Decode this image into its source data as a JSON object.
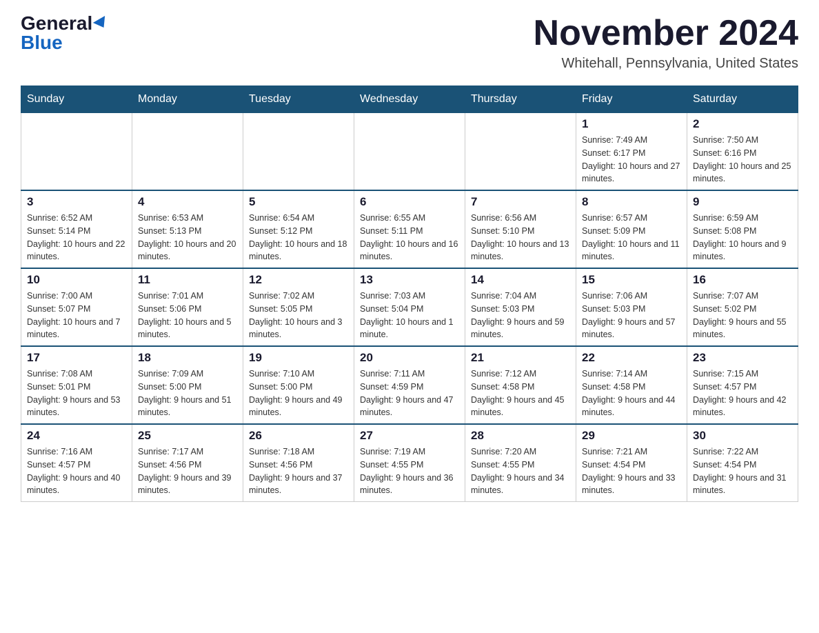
{
  "header": {
    "logo_general": "General",
    "logo_blue": "Blue",
    "month_title": "November 2024",
    "location": "Whitehall, Pennsylvania, United States"
  },
  "calendar": {
    "days_of_week": [
      "Sunday",
      "Monday",
      "Tuesday",
      "Wednesday",
      "Thursday",
      "Friday",
      "Saturday"
    ],
    "weeks": [
      [
        {
          "day": "",
          "sunrise": "",
          "sunset": "",
          "daylight": ""
        },
        {
          "day": "",
          "sunrise": "",
          "sunset": "",
          "daylight": ""
        },
        {
          "day": "",
          "sunrise": "",
          "sunset": "",
          "daylight": ""
        },
        {
          "day": "",
          "sunrise": "",
          "sunset": "",
          "daylight": ""
        },
        {
          "day": "",
          "sunrise": "",
          "sunset": "",
          "daylight": ""
        },
        {
          "day": "1",
          "sunrise": "Sunrise: 7:49 AM",
          "sunset": "Sunset: 6:17 PM",
          "daylight": "Daylight: 10 hours and 27 minutes."
        },
        {
          "day": "2",
          "sunrise": "Sunrise: 7:50 AM",
          "sunset": "Sunset: 6:16 PM",
          "daylight": "Daylight: 10 hours and 25 minutes."
        }
      ],
      [
        {
          "day": "3",
          "sunrise": "Sunrise: 6:52 AM",
          "sunset": "Sunset: 5:14 PM",
          "daylight": "Daylight: 10 hours and 22 minutes."
        },
        {
          "day": "4",
          "sunrise": "Sunrise: 6:53 AM",
          "sunset": "Sunset: 5:13 PM",
          "daylight": "Daylight: 10 hours and 20 minutes."
        },
        {
          "day": "5",
          "sunrise": "Sunrise: 6:54 AM",
          "sunset": "Sunset: 5:12 PM",
          "daylight": "Daylight: 10 hours and 18 minutes."
        },
        {
          "day": "6",
          "sunrise": "Sunrise: 6:55 AM",
          "sunset": "Sunset: 5:11 PM",
          "daylight": "Daylight: 10 hours and 16 minutes."
        },
        {
          "day": "7",
          "sunrise": "Sunrise: 6:56 AM",
          "sunset": "Sunset: 5:10 PM",
          "daylight": "Daylight: 10 hours and 13 minutes."
        },
        {
          "day": "8",
          "sunrise": "Sunrise: 6:57 AM",
          "sunset": "Sunset: 5:09 PM",
          "daylight": "Daylight: 10 hours and 11 minutes."
        },
        {
          "day": "9",
          "sunrise": "Sunrise: 6:59 AM",
          "sunset": "Sunset: 5:08 PM",
          "daylight": "Daylight: 10 hours and 9 minutes."
        }
      ],
      [
        {
          "day": "10",
          "sunrise": "Sunrise: 7:00 AM",
          "sunset": "Sunset: 5:07 PM",
          "daylight": "Daylight: 10 hours and 7 minutes."
        },
        {
          "day": "11",
          "sunrise": "Sunrise: 7:01 AM",
          "sunset": "Sunset: 5:06 PM",
          "daylight": "Daylight: 10 hours and 5 minutes."
        },
        {
          "day": "12",
          "sunrise": "Sunrise: 7:02 AM",
          "sunset": "Sunset: 5:05 PM",
          "daylight": "Daylight: 10 hours and 3 minutes."
        },
        {
          "day": "13",
          "sunrise": "Sunrise: 7:03 AM",
          "sunset": "Sunset: 5:04 PM",
          "daylight": "Daylight: 10 hours and 1 minute."
        },
        {
          "day": "14",
          "sunrise": "Sunrise: 7:04 AM",
          "sunset": "Sunset: 5:03 PM",
          "daylight": "Daylight: 9 hours and 59 minutes."
        },
        {
          "day": "15",
          "sunrise": "Sunrise: 7:06 AM",
          "sunset": "Sunset: 5:03 PM",
          "daylight": "Daylight: 9 hours and 57 minutes."
        },
        {
          "day": "16",
          "sunrise": "Sunrise: 7:07 AM",
          "sunset": "Sunset: 5:02 PM",
          "daylight": "Daylight: 9 hours and 55 minutes."
        }
      ],
      [
        {
          "day": "17",
          "sunrise": "Sunrise: 7:08 AM",
          "sunset": "Sunset: 5:01 PM",
          "daylight": "Daylight: 9 hours and 53 minutes."
        },
        {
          "day": "18",
          "sunrise": "Sunrise: 7:09 AM",
          "sunset": "Sunset: 5:00 PM",
          "daylight": "Daylight: 9 hours and 51 minutes."
        },
        {
          "day": "19",
          "sunrise": "Sunrise: 7:10 AM",
          "sunset": "Sunset: 5:00 PM",
          "daylight": "Daylight: 9 hours and 49 minutes."
        },
        {
          "day": "20",
          "sunrise": "Sunrise: 7:11 AM",
          "sunset": "Sunset: 4:59 PM",
          "daylight": "Daylight: 9 hours and 47 minutes."
        },
        {
          "day": "21",
          "sunrise": "Sunrise: 7:12 AM",
          "sunset": "Sunset: 4:58 PM",
          "daylight": "Daylight: 9 hours and 45 minutes."
        },
        {
          "day": "22",
          "sunrise": "Sunrise: 7:14 AM",
          "sunset": "Sunset: 4:58 PM",
          "daylight": "Daylight: 9 hours and 44 minutes."
        },
        {
          "day": "23",
          "sunrise": "Sunrise: 7:15 AM",
          "sunset": "Sunset: 4:57 PM",
          "daylight": "Daylight: 9 hours and 42 minutes."
        }
      ],
      [
        {
          "day": "24",
          "sunrise": "Sunrise: 7:16 AM",
          "sunset": "Sunset: 4:57 PM",
          "daylight": "Daylight: 9 hours and 40 minutes."
        },
        {
          "day": "25",
          "sunrise": "Sunrise: 7:17 AM",
          "sunset": "Sunset: 4:56 PM",
          "daylight": "Daylight: 9 hours and 39 minutes."
        },
        {
          "day": "26",
          "sunrise": "Sunrise: 7:18 AM",
          "sunset": "Sunset: 4:56 PM",
          "daylight": "Daylight: 9 hours and 37 minutes."
        },
        {
          "day": "27",
          "sunrise": "Sunrise: 7:19 AM",
          "sunset": "Sunset: 4:55 PM",
          "daylight": "Daylight: 9 hours and 36 minutes."
        },
        {
          "day": "28",
          "sunrise": "Sunrise: 7:20 AM",
          "sunset": "Sunset: 4:55 PM",
          "daylight": "Daylight: 9 hours and 34 minutes."
        },
        {
          "day": "29",
          "sunrise": "Sunrise: 7:21 AM",
          "sunset": "Sunset: 4:54 PM",
          "daylight": "Daylight: 9 hours and 33 minutes."
        },
        {
          "day": "30",
          "sunrise": "Sunrise: 7:22 AM",
          "sunset": "Sunset: 4:54 PM",
          "daylight": "Daylight: 9 hours and 31 minutes."
        }
      ]
    ]
  }
}
